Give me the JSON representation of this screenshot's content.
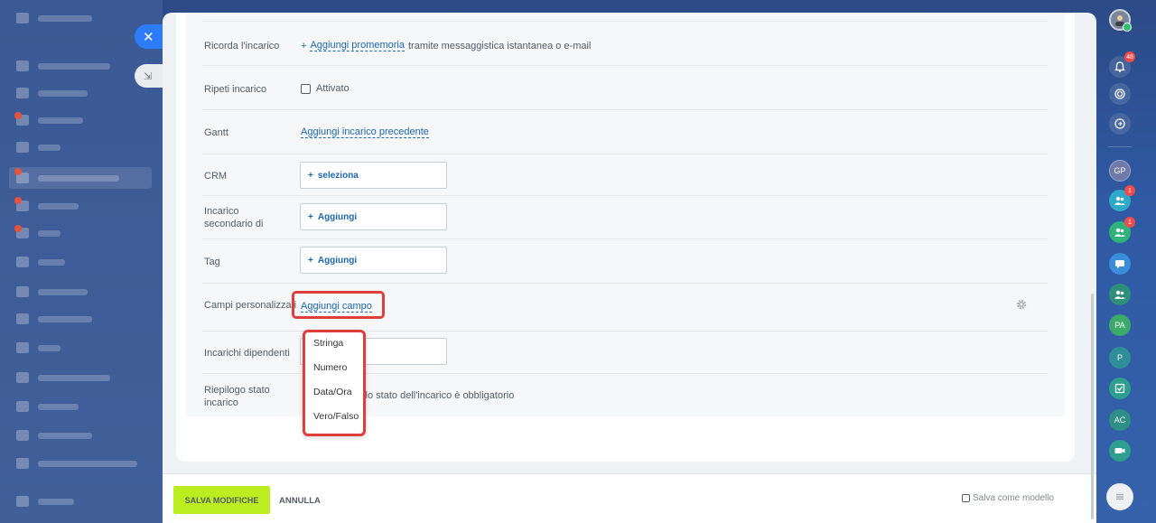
{
  "form": {
    "reminder": {
      "label": "Ricorda l'incarico",
      "plus": "+",
      "link": "Aggiungi promemoria",
      "suffix": "tramite messaggistica istantanea o e-mail"
    },
    "repeat": {
      "label": "Ripeti incarico",
      "checkbox_label": "Attivato"
    },
    "gantt": {
      "label": "Gantt",
      "link": "Aggiungi incarico precedente"
    },
    "crm": {
      "label": "CRM",
      "button": "seleziona"
    },
    "subtask": {
      "label": "Incarico secondario di",
      "button": "Aggiungi"
    },
    "tag": {
      "label": "Tag",
      "button": "Aggiungi"
    },
    "custom_fields": {
      "label": "Campi personalizzati",
      "link": "Aggiungi campo"
    },
    "dependent": {
      "label": "Incarichi dipendenti"
    },
    "status_summary": {
      "label": "Riepilogo stato incarico",
      "text": "ello stato dell'incarico è obbligatorio"
    }
  },
  "dropdown": {
    "options": [
      "Stringa",
      "Numero",
      "Data/Ora",
      "Vero/Falso"
    ]
  },
  "footer": {
    "save_label": "SALVA MODIFICHE",
    "cancel_label": "ANNULLA",
    "save_as_template": "Salva come modello"
  },
  "right_bar": {
    "notifications_badge": "48",
    "group_badge_1": "1",
    "group_badge_2": "1",
    "initials": [
      "GP",
      "PA",
      "P",
      "AC"
    ]
  },
  "colors": {
    "accent": "#2067b0",
    "save": "#bbed21",
    "highlight": "#e03d3d"
  }
}
